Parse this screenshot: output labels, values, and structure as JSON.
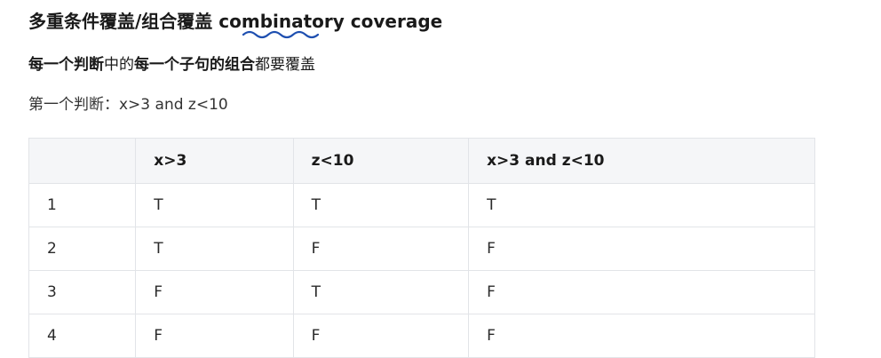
{
  "heading": {
    "cn": "多重条件覆盖/组合覆盖 ",
    "en": "combinatory coverage"
  },
  "subheading": {
    "strong1": "每一个判断",
    "normal1": "中的",
    "strong2": "每一个子句的组合",
    "normal2": "都要覆盖"
  },
  "decision_line": "第一个判断：x>3 and z<10",
  "table": {
    "headers": [
      "",
      "x>3",
      "z<10",
      "x>3 and z<10"
    ],
    "rows": [
      [
        "1",
        "T",
        "T",
        "T"
      ],
      [
        "2",
        "T",
        "F",
        "F"
      ],
      [
        "3",
        "F",
        "T",
        "F"
      ],
      [
        "4",
        "F",
        "F",
        "F"
      ]
    ]
  },
  "colors": {
    "squiggle": "#1e4fb0",
    "header_bg": "#f5f6f8",
    "border": "#e2e4e8"
  }
}
